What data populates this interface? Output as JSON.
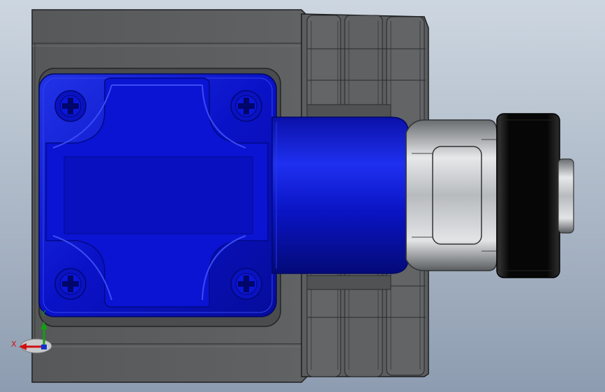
{
  "viewport": {
    "background_top": "#cdd6e0",
    "background_bottom": "#8d9cb0"
  },
  "colors": {
    "housing": "#5f6164",
    "housing_dark": "#2b2c2e",
    "cover": "#0a12c8",
    "cover_dark": "#000a7a",
    "roller": "#050505",
    "metal": "#b4b7ba",
    "axis_x": "#d01010",
    "axis_y": "#10a010"
  },
  "triad": {
    "x_label": "X",
    "y_label": "Y"
  }
}
